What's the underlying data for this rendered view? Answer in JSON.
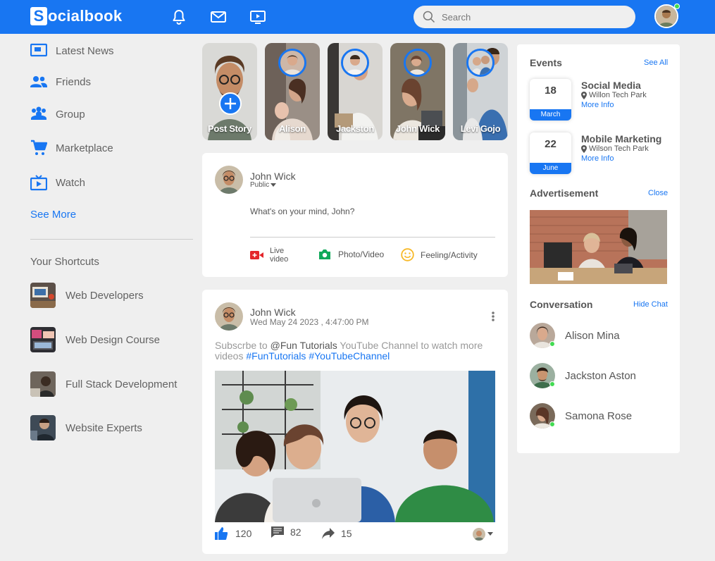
{
  "brand": {
    "logo_letter": "S",
    "logo_rest": "ocialbook"
  },
  "search": {
    "placeholder": "Search"
  },
  "sidebar": {
    "items": [
      {
        "label": "Latest News"
      },
      {
        "label": "Friends"
      },
      {
        "label": "Group"
      },
      {
        "label": "Marketplace"
      },
      {
        "label": "Watch"
      }
    ],
    "see_more": "See More",
    "shortcuts_title": "Your Shortcuts",
    "shortcuts": [
      {
        "label": "Web Developers"
      },
      {
        "label": "Web Design Course"
      },
      {
        "label": "Full Stack Development"
      },
      {
        "label": "Website Experts"
      }
    ]
  },
  "stories": [
    {
      "name": "Post Story"
    },
    {
      "name": "Alison"
    },
    {
      "name": "Jackston"
    },
    {
      "name": "John Wick"
    },
    {
      "name": "Levi Gojo"
    }
  ],
  "composer": {
    "user_name": "John Wick",
    "privacy": "Public",
    "placeholder": "What's on your mind, John?",
    "actions": [
      {
        "label": "Live video"
      },
      {
        "label": "Photo/Video"
      },
      {
        "label": "Feeling/Activity"
      }
    ]
  },
  "post": {
    "user_name": "John Wick",
    "timestamp": "Wed May 24 2023 , 4:47:00 PM",
    "text_1": "Subscrbe to",
    "mention": "@Fun Tutorials",
    "text_2": "YouTube Channel to watch more videos",
    "hashtag_1": "#FunTutorials",
    "hashtag_2": "#YouTubeChannel",
    "likes": "120",
    "comments": "82",
    "shares": "15"
  },
  "events": {
    "title": "Events",
    "see_all": "See All",
    "items": [
      {
        "day": "18",
        "month": "March",
        "title": "Social Media",
        "location": "Willon Tech Park",
        "more": "More Info"
      },
      {
        "day": "22",
        "month": "June",
        "title": "Mobile Marketing",
        "location": "Wilson Tech Park",
        "more": "More Info"
      }
    ]
  },
  "advertisement": {
    "title": "Advertisement",
    "close": "Close"
  },
  "conversation": {
    "title": "Conversation",
    "hide": "Hide Chat",
    "contacts": [
      {
        "name": "Alison Mina"
      },
      {
        "name": "Jackston Aston"
      },
      {
        "name": "Samona Rose"
      }
    ]
  },
  "colors": {
    "primary": "#1876f2",
    "online": "#41db51",
    "live": "#e4262b",
    "photo": "#10a95a",
    "feeling": "#f7b928"
  }
}
